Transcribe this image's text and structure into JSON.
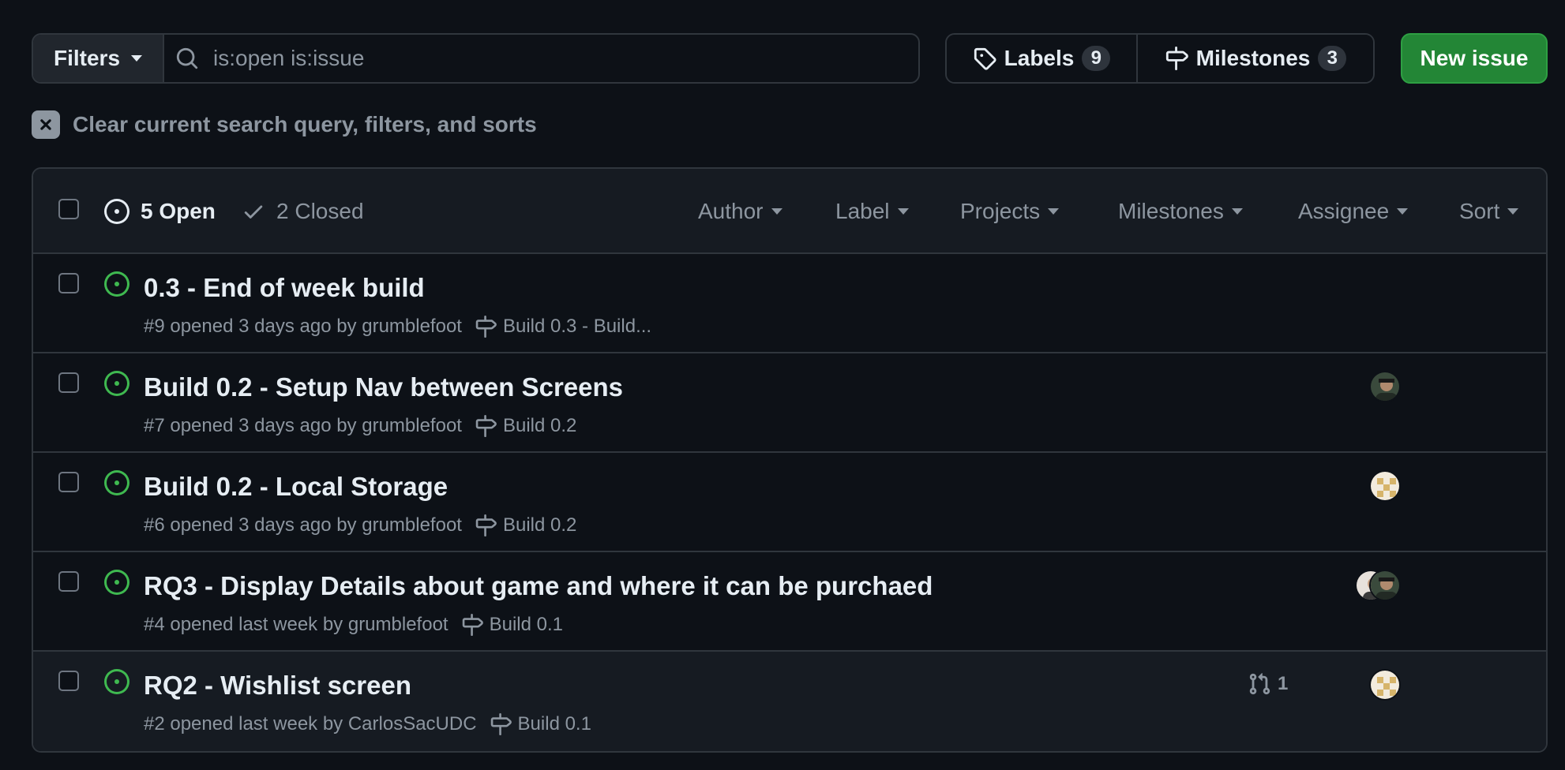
{
  "toolbar": {
    "filters_label": "Filters",
    "search_value": "is:open is:issue",
    "labels_label": "Labels",
    "labels_count": "9",
    "milestones_label": "Milestones",
    "milestones_count": "3",
    "new_issue_label": "New issue"
  },
  "clear_query_label": "Clear current search query, filters, and sorts",
  "list_header": {
    "open_label": "5 Open",
    "closed_label": "2 Closed",
    "filters": [
      "Author",
      "Label",
      "Projects",
      "Milestones",
      "Assignee",
      "Sort"
    ]
  },
  "issues": [
    {
      "title": "0.3 - End of week build",
      "meta": "#9 opened 3 days ago by grumblefoot",
      "milestone": "Build 0.3 - Build...",
      "assignees": []
    },
    {
      "title": "Build 0.2 - Setup Nav between Screens",
      "meta": "#7 opened 3 days ago by grumblefoot",
      "milestone": "Build 0.2",
      "assignees": [
        "photo"
      ]
    },
    {
      "title": "Build 0.2 - Local Storage",
      "meta": "#6 opened 3 days ago by grumblefoot",
      "milestone": "Build 0.2",
      "assignees": [
        "identicon"
      ]
    },
    {
      "title": "RQ3 - Display Details about game and where it can be purchaed",
      "meta": "#4 opened last week by grumblefoot",
      "milestone": "Build 0.1",
      "assignees": [
        "photo-light",
        "photo"
      ]
    },
    {
      "title": "RQ2 - Wishlist screen",
      "meta": "#2 opened last week by CarlosSacUDC",
      "milestone": "Build 0.1",
      "linked_prs": "1",
      "assignees": [
        "identicon"
      ]
    }
  ],
  "colors": {
    "background": "#0d1117",
    "open_green": "#3fb950",
    "primary_button": "#238636",
    "muted_text": "#8d96a0",
    "border": "#30363d"
  }
}
